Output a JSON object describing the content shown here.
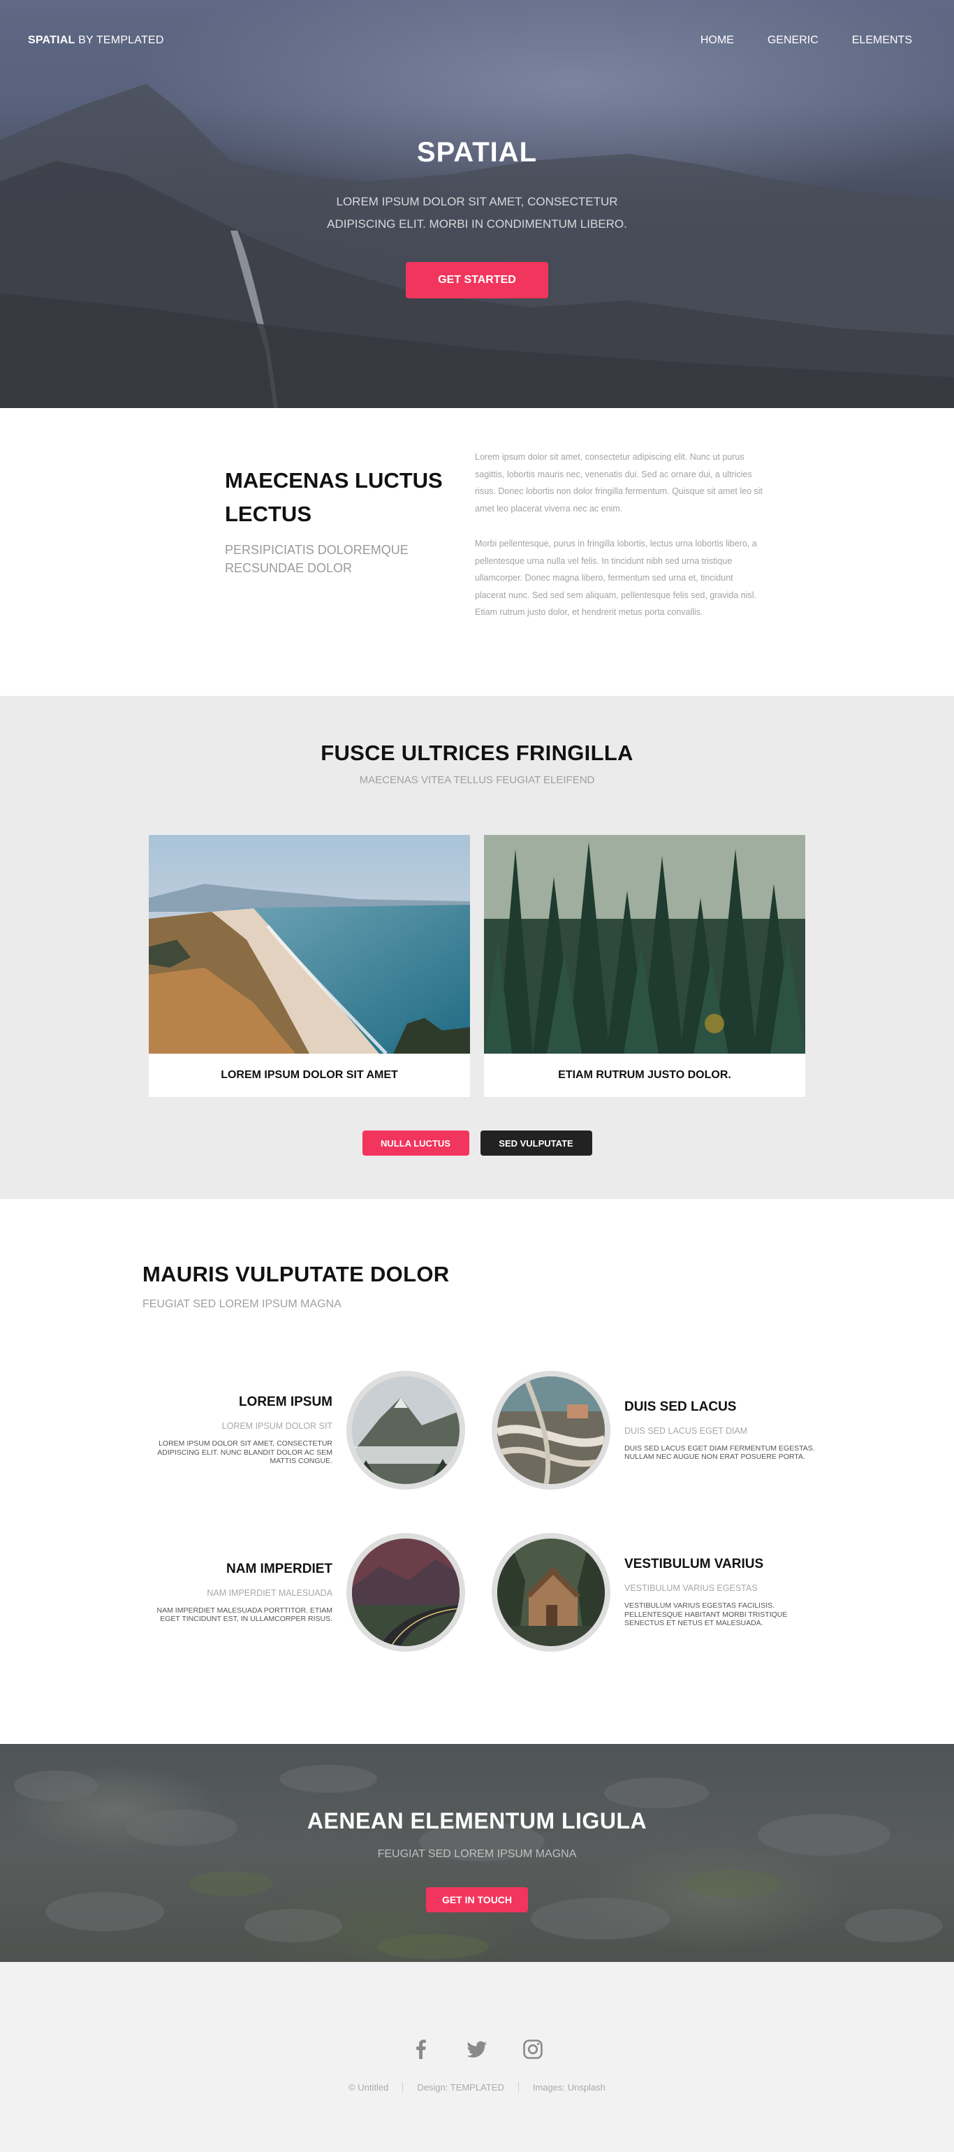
{
  "header": {
    "logo_bold": "SPATIAL",
    "logo_rest": " BY TEMPLATED",
    "nav": [
      {
        "label": "HOME"
      },
      {
        "label": "GENERIC"
      },
      {
        "label": "ELEMENTS"
      }
    ]
  },
  "hero": {
    "title": "SPATIAL",
    "subtitle": "LOREM IPSUM DOLOR SIT AMET, CONSECTETUR ADIPISCING ELIT. MORBI IN CONDIMENTUM LIBERO.",
    "button": "GET STARTED"
  },
  "intro": {
    "title": "MAECENAS LUCTUS LECTUS",
    "subtitle": "PERSIPICIATIS DOLOREMQUE RECSUNDAE DOLOR",
    "paragraphs": [
      "Lorem ipsum dolor sit amet, consectetur adipiscing elit. Nunc ut purus sagittis, lobortis mauris nec, venenatis dui. Sed ac ornare dui, a ultricies risus. Donec lobortis non dolor fringilla fermentum. Quisque sit amet leo sit amet leo placerat viverra nec ac enim.",
      "Morbi pellentesque, purus in fringilla lobortis, lectus urna lobortis libero, a pellentesque urna nulla vel felis. In tincidunt nibh sed urna tristique ullamcorper. Donec magna libero, fermentum sed urna et, tincidunt placerat nunc. Sed sed sem aliquam, pellentesque felis sed, gravida nisl. Etiam rutrum justo dolor, et hendrerit metus porta convallis."
    ]
  },
  "gallery": {
    "title": "FUSCE ULTRICES FRINGILLA",
    "subtitle": "MAECENAS VITEA TELLUS FEUGIAT ELEIFEND",
    "cards": [
      {
        "caption": "LOREM IPSUM DOLOR SIT AMET"
      },
      {
        "caption": "ETIAM RUTRUM JUSTO DOLOR."
      }
    ],
    "buttons": {
      "primary": "NULLA LUCTUS",
      "secondary": "SED VULPUTATE"
    }
  },
  "features": {
    "title": "MAURIS VULPUTATE DOLOR",
    "subtitle": "FEUGIAT SED LOREM IPSUM MAGNA",
    "items": [
      {
        "title": "LOREM IPSUM",
        "sub": "LOREM IPSUM DOLOR SIT",
        "desc": "LOREM IPSUM DOLOR SIT AMET, CONSECTETUR ADIPISCING ELIT. NUNC BLANDIT DOLOR AC SEM MATTIS CONGUE."
      },
      {
        "title": "DUIS SED LACUS",
        "sub": "DUIS SED LACUS EGET DIAM",
        "desc": "DUIS SED LACUS EGET DIAM FERMENTUM EGESTAS. NULLAM NEC AUGUE NON ERAT POSUERE PORTA."
      },
      {
        "title": "NAM IMPERDIET",
        "sub": "NAM IMPERDIET MALESUADA",
        "desc": "NAM IMPERDIET MALESUADA PORTTITOR. ETIAM EGET TINCIDUNT EST, IN ULLAMCORPER RISUS."
      },
      {
        "title": "VESTIBULUM VARIUS",
        "sub": "VESTIBULUM VARIUS EGESTAS",
        "desc": "VESTIBULUM VARIUS EGESTAS FACILISIS. PELLENTESQUE HABITANT MORBI TRISTIQUE SENECTUS ET NETUS ET MALESUADA."
      }
    ]
  },
  "cta": {
    "title": "AENEAN ELEMENTUM LIGULA",
    "subtitle": "FEUGIAT SED LOREM IPSUM MAGNA",
    "button": "GET IN TOUCH"
  },
  "footer": {
    "social": [
      {
        "icon": "facebook-icon"
      },
      {
        "icon": "twitter-icon"
      },
      {
        "icon": "instagram-icon"
      }
    ],
    "copyright": "© Untitled",
    "design": "Design: TEMPLATED",
    "images": "Images: Unsplash"
  },
  "colors": {
    "accent": "#f2355c",
    "dark_button": "#222222",
    "gallery_bg": "#ebebeb",
    "footer_bg": "#f2f2f2"
  }
}
